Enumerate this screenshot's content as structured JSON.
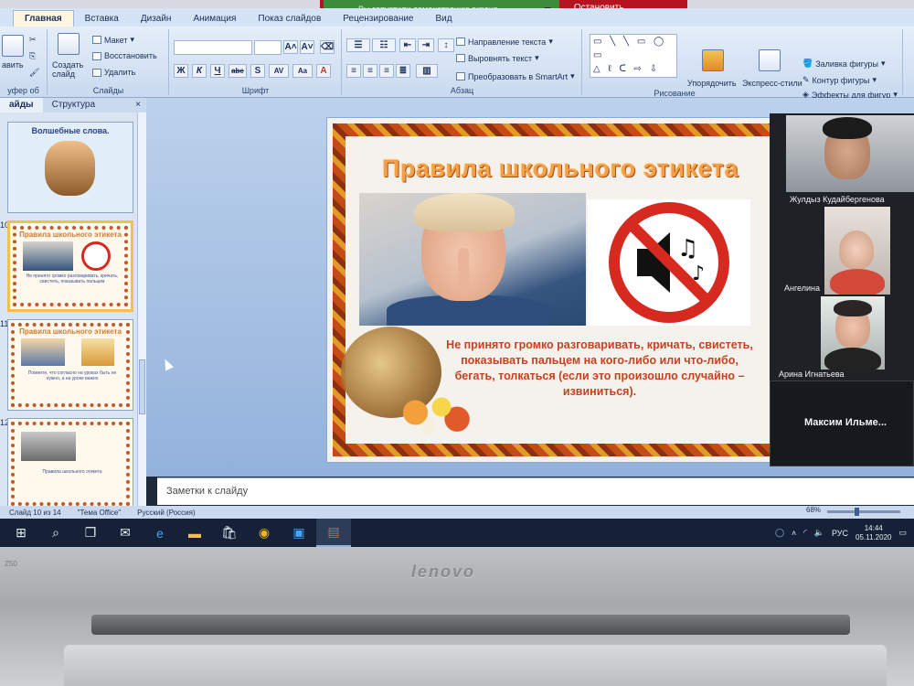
{
  "notification": {
    "sharing_text": "Вы запустили демонстрацию экрана",
    "stop_label": "Остановить демонстрацию"
  },
  "ribbon": {
    "tabs": [
      "Главная",
      "Вставка",
      "Дизайн",
      "Анимация",
      "Показ слайдов",
      "Рецензирование",
      "Вид"
    ],
    "active_tab": "Главная",
    "slides_group": {
      "label": "Слайды",
      "paste": "авить",
      "create_slide": "Создать слайд",
      "layout": "Макет",
      "restore": "Восстановить",
      "delete": "Удалить"
    },
    "font_group": {
      "label": "Шрифт",
      "bold": "Ж",
      "italic": "К",
      "underline": "Ч",
      "strike": "abe",
      "shadow": "S",
      "spacing": "AV",
      "case": "Aa",
      "color": "A"
    },
    "paragraph_group": {
      "label": "Абзац",
      "text_direction": "Направление текста",
      "align_text": "Выровнять текст",
      "smartart": "Преобразовать в SmartArt"
    },
    "drawing_group": {
      "label": "Рисование",
      "arrange": "Упорядочить",
      "quick_styles": "Экспресс-стили",
      "shape_fill": "Заливка фигуры",
      "shape_outline": "Контур фигуры",
      "shape_effects": "Эффекты для фигур"
    },
    "clipboard_label": "уфер об",
    "shapes_row1": "▭ ╲ ╲ ▭ ◯ ▭",
    "shapes_row2": "△ ℓ ᑕ ⇨ ⇩ ☁",
    "shapes_row3": "⇘ ⁀ ⌒ { } ☆"
  },
  "panel": {
    "tab_slides": "айды",
    "tab_outline": "Структура",
    "close": "×"
  },
  "thumbnails": [
    {
      "num": "",
      "title": "Волшебные слова.",
      "text": ""
    },
    {
      "num": "10",
      "title": "Правила школьного этикета",
      "text": "Не принято громко разговаривать, кричать, свистеть, показывать пальцем"
    },
    {
      "num": "11",
      "title": "Правила школьного этикета",
      "text": "Помните, что согласно на уроках быть не нужно, а на уроке важно"
    },
    {
      "num": "12",
      "title": "",
      "text": "Правила школьного этикета"
    }
  ],
  "slide": {
    "title": "Правила школьного этикета",
    "body": "Не принято громко разговаривать, кричать, свистеть, показывать пальцем на кого-либо или что-либо, бегать, толкаться (если это произошло случайно – извиниться)."
  },
  "notes": {
    "placeholder": "Заметки к слайду"
  },
  "status": {
    "slide_counter": "Слайд 10 из 14",
    "theme": "\"Тема Office\"",
    "language": "Русский (Россия)",
    "zoom": "68%"
  },
  "participants": [
    {
      "name": "Жулдыз Кудайбергенова"
    },
    {
      "name": "Ангелина"
    },
    {
      "name": "Арина Игнатьева"
    },
    {
      "name": "Максим  Ильме..."
    }
  ],
  "taskbar": {
    "icons": [
      "windows-icon",
      "search-icon",
      "task-view-icon",
      "mail-icon",
      "edge-icon",
      "explorer-icon",
      "store-icon",
      "chrome-icon",
      "zoom-icon",
      "powerpoint-icon"
    ],
    "lang": "РУС",
    "time": "14:44",
    "date": "05.11.2020"
  },
  "laptop": {
    "brand": "lenovo",
    "model": "Z50"
  }
}
